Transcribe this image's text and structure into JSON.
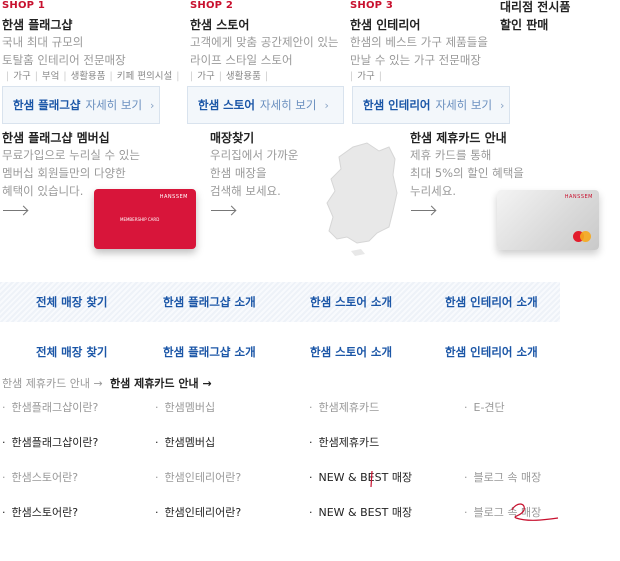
{
  "shops": [
    {
      "label": "SHOP 1",
      "title": "한샘 플래그샵",
      "desc1": "국내 최대 규모의",
      "desc2": "토탈홈 인테리어 전문매장",
      "tags": [
        "가구",
        "부엌",
        "생활용품",
        "키페 편의시설"
      ],
      "button_name": "한샘 플래그샵",
      "button_view": "자세히 보기"
    },
    {
      "label": "SHOP 2",
      "title": "한샘 스토어",
      "desc1": "고객에게 맞춤 공간제안이 있는",
      "desc2": "라이프 스타일 스토어",
      "tags": [
        "가구",
        "생활용품"
      ],
      "button_name": "한샘 스토어",
      "button_view": "자세히 보기"
    },
    {
      "label": "SHOP 3",
      "title": "한샘 인테리어",
      "desc1": "한샘의 베스트 가구 제품들을",
      "desc2": "만날 수 있는 가구 전문매장",
      "tags": [
        "가구"
      ],
      "button_name": "한샘 인테리어",
      "button_view": "자세히 보기"
    }
  ],
  "showroom": {
    "line1": "대리점 전시품",
    "line2": "할인 판매"
  },
  "membership": {
    "title": "한샘 플래그샵 멤버십",
    "desc1": "무료가입으로 누리실 수 있는",
    "desc2": "멤버십 회원들만의 다양한",
    "desc3": "혜택이 있습니다.",
    "card_text": "MEMBERSHIP CARD",
    "card_brand": "HANSSEM"
  },
  "store_find": {
    "title": "매장찾기",
    "desc1": "우리집에서 가까운",
    "desc2": "한샘 매장을",
    "desc3": "검색해 보세요."
  },
  "partner_card": {
    "title": "한샘 제휴카드 안내",
    "desc1": "제휴 카드를 통해",
    "desc2": "최대 5%의 할인 혜택을",
    "desc3": "누리세요.",
    "card_brand": "HANSSEM"
  },
  "nav_row_1": [
    "전체 매장 찾기",
    "한샘 플래그샵 소개",
    "한샘 스토어 소개",
    "한샘 인테리어 소개"
  ],
  "nav_row_2": [
    "전체 매장 찾기",
    "한샘 플래그샵 소개",
    "한샘 스토어 소개",
    "한샘 인테리어 소개"
  ],
  "card_guide": {
    "grey": "한샘 제휴카드 안내 →",
    "dark": "한샘 제휴카드 안내 →"
  },
  "links_row_1": [
    "한샘플래그샵이란?",
    "한샘멤버십",
    "한샘제휴카드",
    "E-견단"
  ],
  "links_row_2": [
    "한샘플래그샵이란?",
    "한샘멤버십",
    "한샘제휴카드"
  ],
  "links_row_3": [
    "한샘스토어란?",
    "한샘인테리어란?",
    "NEW & BEST 매장",
    "블로그 속 매장"
  ],
  "links_row_4": [
    "한샘스토어란?",
    "한샘인테리어란?",
    "NEW & BEST 매장",
    "블로그 속 매장"
  ],
  "colors": {
    "accent_red": "#c8102e",
    "link_blue": "#1b56a7"
  },
  "icons": {
    "chevron": "chevron-right-icon",
    "arrow": "long-arrow-right-icon"
  }
}
